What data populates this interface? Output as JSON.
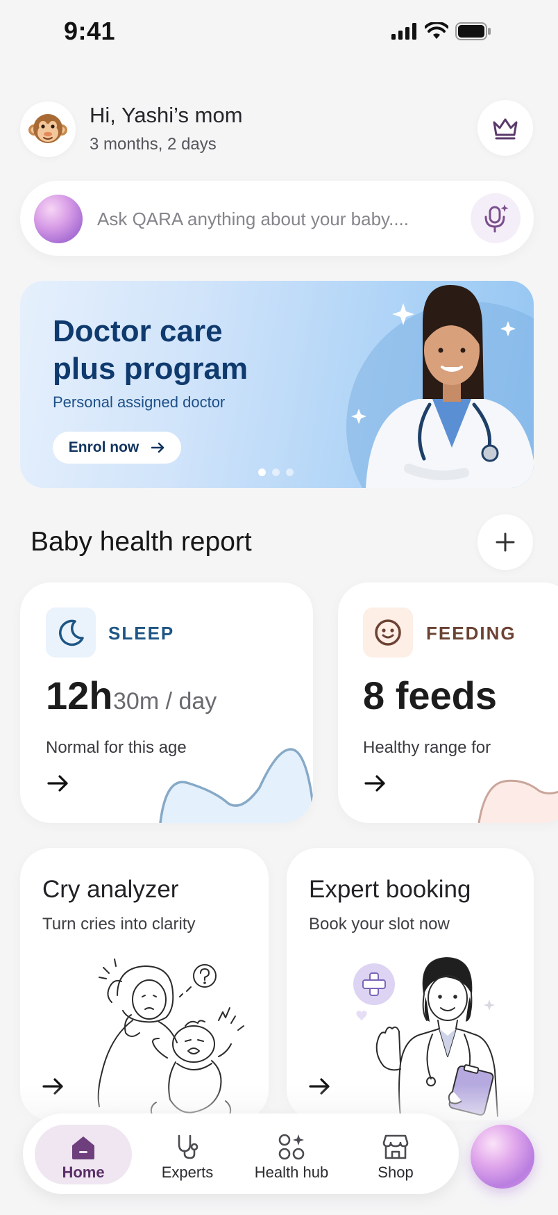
{
  "status_bar": {
    "time": "9:41"
  },
  "header": {
    "avatar_icon": "monkey-icon",
    "greeting": "Hi, Yashi’s mom",
    "baby_age": "3 months, 2 days",
    "premium_icon": "crown-icon"
  },
  "search": {
    "placeholder": "Ask QARA anything about your baby....",
    "mic_icon": "ai-mic-icon"
  },
  "banner": {
    "title": "Doctor care plus program",
    "subtitle": "Personal assigned doctor",
    "cta_label": "Enrol now",
    "slides_total": 3,
    "active_slide": 1
  },
  "health_report": {
    "title": "Baby health report",
    "add_icon": "plus-icon",
    "cards": [
      {
        "label": "SLEEP",
        "icon": "moon-icon",
        "value_main": "12h",
        "value_secondary": "30m / day",
        "note": "Normal for this age",
        "accent": "#1e5584"
      },
      {
        "label": "FEEDING",
        "icon": "smiley-icon",
        "value_main": "8 feeds",
        "note": "Healthy range for",
        "accent": "#6b4233"
      }
    ]
  },
  "features": [
    {
      "title": "Cry analyzer",
      "subtitle": "Turn cries into clarity"
    },
    {
      "title": "Expert booking",
      "subtitle": "Book your slot now"
    }
  ],
  "bottom_nav": {
    "items": [
      {
        "label": "Home",
        "icon": "home-icon",
        "active": true
      },
      {
        "label": "Experts",
        "icon": "stethoscope-icon",
        "active": false
      },
      {
        "label": "Health hub",
        "icon": "apps-sparkle-icon",
        "active": false
      },
      {
        "label": "Shop",
        "icon": "store-icon",
        "active": false
      }
    ],
    "assistant_icon": "qara-orb-icon"
  },
  "colors": {
    "background": "#f5f5f6",
    "banner_title": "#0f3a6e",
    "nav_active": "#5a2f67",
    "sleep_chart_fill": "#e4f0fc",
    "feeding_chart_fill": "#fcebe6"
  }
}
